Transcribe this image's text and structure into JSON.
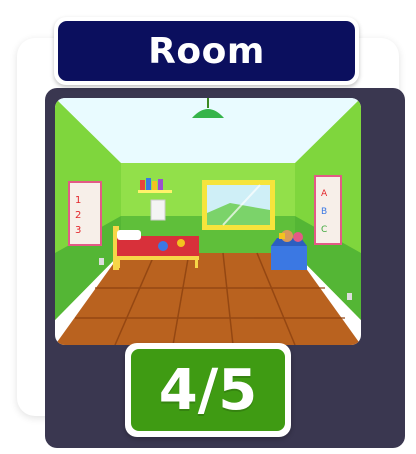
{
  "card": {
    "title": "Room",
    "progress_label": "4/5"
  },
  "picture": {
    "icon": "room-illustration"
  },
  "colors": {
    "card_background": "#3a3750",
    "title_background": "#0b0f5e",
    "progress_background": "#3f9b13",
    "wall": "#8fe34a",
    "floor": "#b75a1a"
  }
}
